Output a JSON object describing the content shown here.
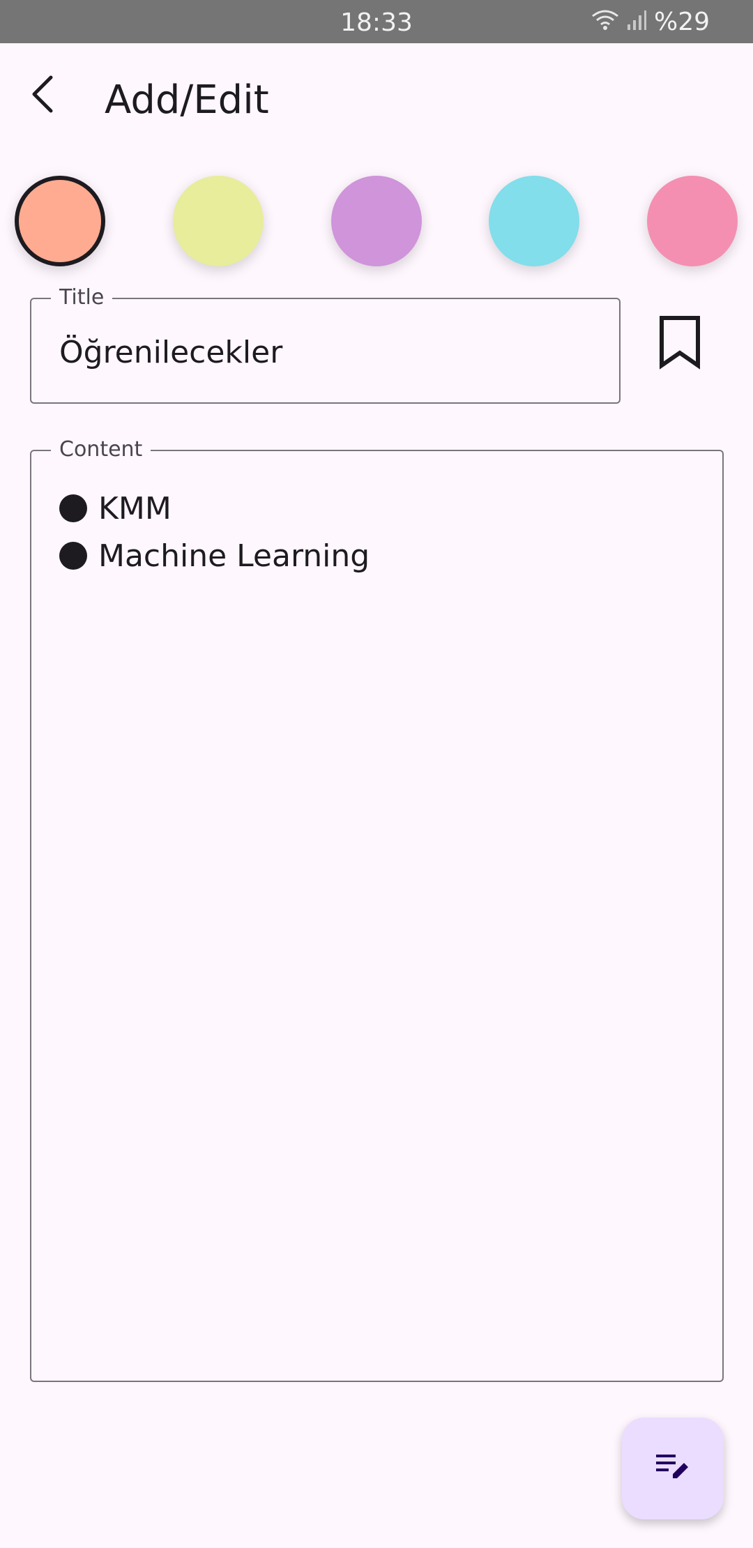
{
  "status_bar": {
    "time": "18:33",
    "battery": "%29",
    "icons": [
      "wifi-icon",
      "signal-icon"
    ]
  },
  "app_bar": {
    "title": "Add/Edit",
    "back_icon": "chevron-left-icon"
  },
  "color_swatches": [
    {
      "name": "peach",
      "color": "#FFAB91",
      "selected": true
    },
    {
      "name": "yellow-green",
      "color": "#E7ED9B",
      "selected": false
    },
    {
      "name": "purple",
      "color": "#CF94DA",
      "selected": false
    },
    {
      "name": "cyan",
      "color": "#81DEEA",
      "selected": false
    },
    {
      "name": "pink",
      "color": "#F48FB1",
      "selected": false
    }
  ],
  "title_field": {
    "label": "Title",
    "value": "Öğrenilecekler"
  },
  "bookmark": {
    "icon": "bookmark-outline-icon"
  },
  "content_field": {
    "label": "Content",
    "items": [
      "KMM",
      "Machine Learning"
    ]
  },
  "fab": {
    "icon": "edit-note-icon",
    "background": "#EADDFF"
  },
  "colors": {
    "background": "#FFF7FE",
    "status_bar": "#757575",
    "text": "#1D1B20",
    "outline": "#79747E"
  }
}
